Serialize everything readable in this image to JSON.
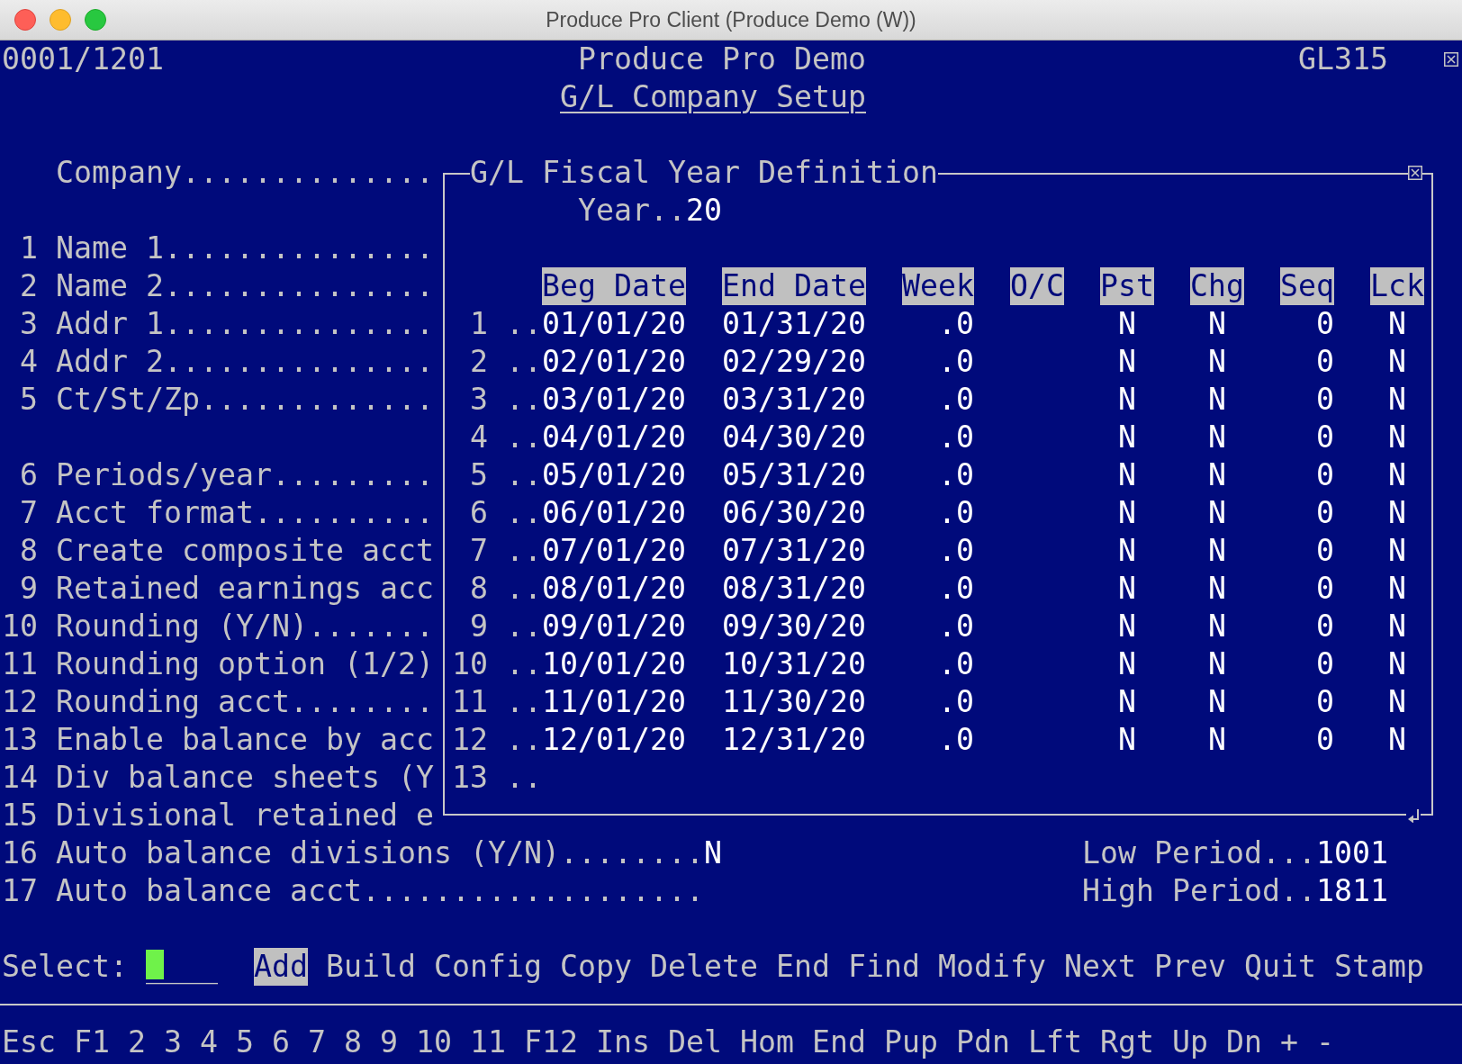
{
  "window": {
    "title": "Produce Pro Client (Produce Demo (W))"
  },
  "header": {
    "terminal_id": "0001/1201",
    "company": "Produce Pro Demo",
    "program_code": "GL315",
    "screen_title": "G/L Company Setup"
  },
  "company_label": "Company..............",
  "field_groups": [
    [
      {
        "number": "1",
        "label": "Name 1..............."
      },
      {
        "number": "2",
        "label": "Name 2..............."
      },
      {
        "number": "3",
        "label": "Addr 1..............."
      },
      {
        "number": "4",
        "label": "Addr 2..............."
      },
      {
        "number": "5",
        "label": "Ct/St/Zp............."
      }
    ],
    [
      {
        "number": "6",
        "label": "Periods/year........."
      },
      {
        "number": "7",
        "label": "Acct format.........."
      },
      {
        "number": "8",
        "label": "Create composite acct"
      },
      {
        "number": "9",
        "label": "Retained earnings acc"
      },
      {
        "number": "10",
        "label": "Rounding (Y/N)......."
      },
      {
        "number": "11",
        "label": "Rounding option (1/2)"
      },
      {
        "number": "12",
        "label": "Rounding acct........"
      },
      {
        "number": "13",
        "label": "Enable balance by acc"
      },
      {
        "number": "14",
        "label": "Div balance sheets (Y"
      },
      {
        "number": "15",
        "label": "Divisional retained e"
      }
    ]
  ],
  "dialog": {
    "title": "G/L Fiscal Year Definition",
    "year_label": "Year..",
    "year_value": "20",
    "columns": [
      "Beg Date",
      "End Date",
      "Week",
      "O/C",
      "Pst",
      "Chg",
      "Seq",
      "Lck"
    ],
    "periods": [
      {
        "number": "1 ..",
        "beg_date": "01/01/20",
        "end_date": "01/31/20",
        "week": ".0",
        "pst": "N",
        "chg": "N",
        "seq": "0",
        "lck": "N"
      },
      {
        "number": "2 ..",
        "beg_date": "02/01/20",
        "end_date": "02/29/20",
        "week": ".0",
        "pst": "N",
        "chg": "N",
        "seq": "0",
        "lck": "N"
      },
      {
        "number": "3 ..",
        "beg_date": "03/01/20",
        "end_date": "03/31/20",
        "week": ".0",
        "pst": "N",
        "chg": "N",
        "seq": "0",
        "lck": "N"
      },
      {
        "number": "4 ..",
        "beg_date": "04/01/20",
        "end_date": "04/30/20",
        "week": ".0",
        "pst": "N",
        "chg": "N",
        "seq": "0",
        "lck": "N"
      },
      {
        "number": "5 ..",
        "beg_date": "05/01/20",
        "end_date": "05/31/20",
        "week": ".0",
        "pst": "N",
        "chg": "N",
        "seq": "0",
        "lck": "N"
      },
      {
        "number": "6 ..",
        "beg_date": "06/01/20",
        "end_date": "06/30/20",
        "week": ".0",
        "pst": "N",
        "chg": "N",
        "seq": "0",
        "lck": "N"
      },
      {
        "number": "7 ..",
        "beg_date": "07/01/20",
        "end_date": "07/31/20",
        "week": ".0",
        "pst": "N",
        "chg": "N",
        "seq": "0",
        "lck": "N"
      },
      {
        "number": "8 ..",
        "beg_date": "08/01/20",
        "end_date": "08/31/20",
        "week": ".0",
        "pst": "N",
        "chg": "N",
        "seq": "0",
        "lck": "N"
      },
      {
        "number": "9 ..",
        "beg_date": "09/01/20",
        "end_date": "09/30/20",
        "week": ".0",
        "pst": "N",
        "chg": "N",
        "seq": "0",
        "lck": "N"
      },
      {
        "number": "10 ..",
        "beg_date": "10/01/20",
        "end_date": "10/31/20",
        "week": ".0",
        "pst": "N",
        "chg": "N",
        "seq": "0",
        "lck": "N"
      },
      {
        "number": "11 ..",
        "beg_date": "11/01/20",
        "end_date": "11/30/20",
        "week": ".0",
        "pst": "N",
        "chg": "N",
        "seq": "0",
        "lck": "N"
      },
      {
        "number": "12 ..",
        "beg_date": "12/01/20",
        "end_date": "12/31/20",
        "week": ".0",
        "pst": "N",
        "chg": "N",
        "seq": "0",
        "lck": "N"
      },
      {
        "number": "13 .."
      }
    ]
  },
  "lower_fields": [
    {
      "number": "16",
      "label": "Auto balance divisions (Y/N)........",
      "value": "N"
    },
    {
      "number": "17",
      "label": "Auto balance acct..................."
    }
  ],
  "period_range": [
    {
      "label": "Low Period...",
      "value": "1001"
    },
    {
      "label": "High Period..",
      "value": "1811"
    }
  ],
  "select_line": {
    "label": "Select:",
    "mask": "____",
    "cursor": true,
    "options": [
      {
        "label": "Add",
        "selected": true
      },
      {
        "label": "Build",
        "selected": false
      },
      {
        "label": "Config",
        "selected": false
      },
      {
        "label": "Copy",
        "selected": false
      },
      {
        "label": "Delete",
        "selected": false
      },
      {
        "label": "End",
        "selected": false
      },
      {
        "label": "Find",
        "selected": false
      },
      {
        "label": "Modify",
        "selected": false
      },
      {
        "label": "Next",
        "selected": false
      },
      {
        "label": "Prev",
        "selected": false
      },
      {
        "label": "Quit",
        "selected": false
      },
      {
        "label": "Stamp",
        "selected": false
      }
    ]
  },
  "function_keys": [
    "Esc",
    "F1",
    "2",
    "3",
    "4",
    "5",
    "6",
    "7",
    "8",
    "9",
    "10",
    "11",
    "F12",
    "Ins",
    "Del",
    "Hom",
    "End",
    "Pup",
    "Pdn",
    "Lft",
    "Rgt",
    "Up",
    "Dn",
    "+",
    "-"
  ]
}
